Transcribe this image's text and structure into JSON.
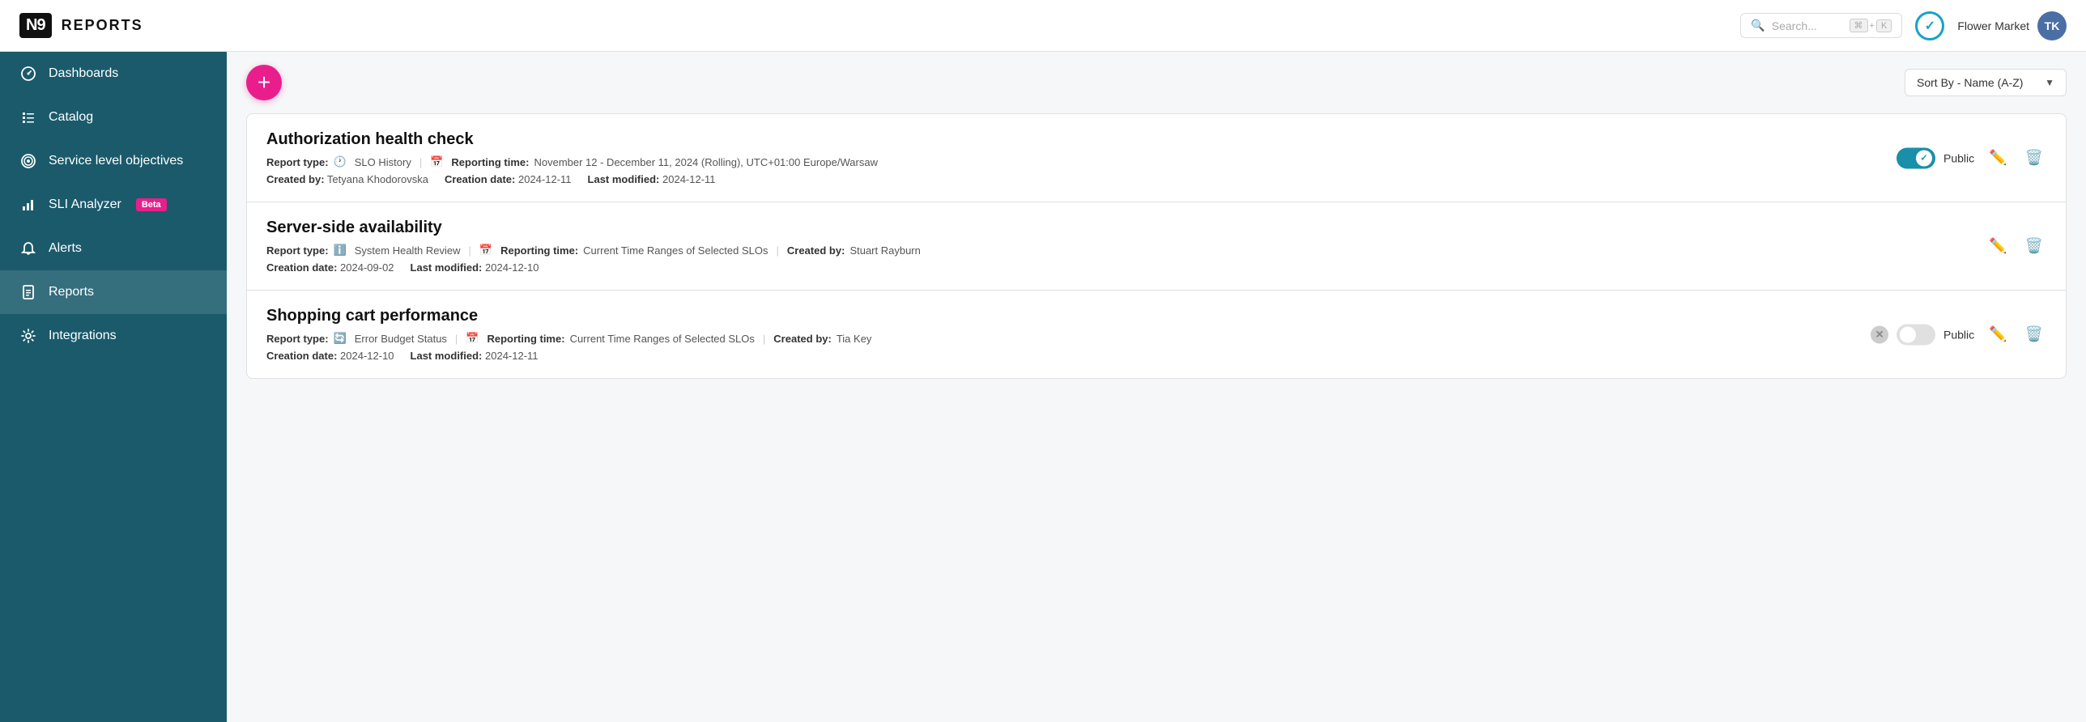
{
  "topbar": {
    "logo": "N9",
    "title": "REPORTS",
    "search_placeholder": "Search...",
    "kbd1": "⌘",
    "kbd2": "K",
    "check_symbol": "✓",
    "workspace": "Flower Market",
    "avatar_initials": "TK"
  },
  "sidebar": {
    "items": [
      {
        "id": "dashboards",
        "label": "Dashboards",
        "icon": "gauge"
      },
      {
        "id": "catalog",
        "label": "Catalog",
        "icon": "list"
      },
      {
        "id": "slo",
        "label": "Service level objectives",
        "icon": "target"
      },
      {
        "id": "sli",
        "label": "SLI Analyzer",
        "icon": "chart",
        "badge": "Beta"
      },
      {
        "id": "alerts",
        "label": "Alerts",
        "icon": "bell"
      },
      {
        "id": "reports",
        "label": "Reports",
        "icon": "document",
        "active": true
      },
      {
        "id": "integrations",
        "label": "Integrations",
        "icon": "gear"
      }
    ]
  },
  "toolbar": {
    "add_label": "+",
    "sort_label": "Sort By - Name (A-Z)"
  },
  "reports": [
    {
      "id": "auth-health",
      "title": "Authorization health check",
      "report_type_label": "Report type:",
      "report_type_icon": "clock",
      "report_type_value": "SLO History",
      "reporting_time_label": "Reporting time:",
      "reporting_time_icon": "calendar",
      "reporting_time_value": "November 12 - December 11, 2024 (Rolling), UTC+01:00 Europe/Warsaw",
      "created_by_label": "Created by:",
      "created_by_value": "Tetyana Khodorovska",
      "creation_date_label": "Creation date:",
      "creation_date_value": "2024-12-11",
      "last_modified_label": "Last modified:",
      "last_modified_value": "2024-12-11",
      "toggle_state": "on",
      "public_label": "Public",
      "has_toggle": true,
      "toggle_on": true
    },
    {
      "id": "server-availability",
      "title": "Server-side availability",
      "report_type_label": "Report type:",
      "report_type_icon": "info",
      "report_type_value": "System Health Review",
      "reporting_time_label": "Reporting time:",
      "reporting_time_icon": "calendar",
      "reporting_time_value": "Current Time Ranges of Selected SLOs",
      "created_by_label": "Created by:",
      "created_by_value": "Stuart Rayburn",
      "creation_date_label": "Creation date:",
      "creation_date_value": "2024-09-02",
      "last_modified_label": "Last modified:",
      "last_modified_value": "2024-12-10",
      "has_toggle": false,
      "toggle_on": false
    },
    {
      "id": "shopping-cart",
      "title": "Shopping cart performance",
      "report_type_label": "Report type:",
      "report_type_icon": "sync",
      "report_type_value": "Error Budget Status",
      "reporting_time_label": "Reporting time:",
      "reporting_time_icon": "calendar",
      "reporting_time_value": "Current Time Ranges of Selected SLOs",
      "created_by_label": "Created by:",
      "created_by_value": "Tia Key",
      "creation_date_label": "Creation date:",
      "creation_date_value": "2024-12-10",
      "last_modified_label": "Last modified:",
      "last_modified_value": "2024-12-11",
      "has_toggle": true,
      "toggle_on": false,
      "public_label": "Public"
    }
  ]
}
